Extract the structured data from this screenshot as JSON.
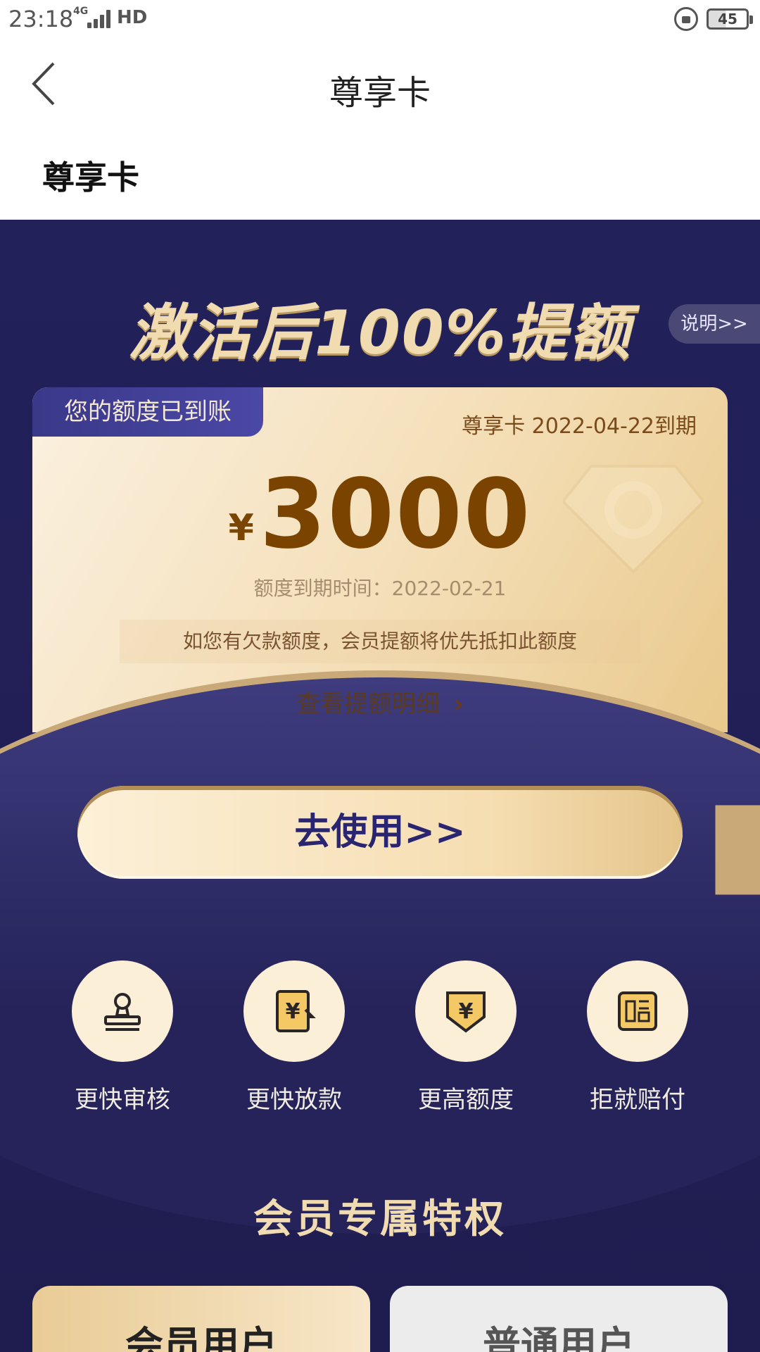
{
  "status_bar": {
    "time": "23:18",
    "network": "4G",
    "hd": "HD",
    "battery": "45"
  },
  "header": {
    "title": "尊享卡",
    "back_icon": "chevron-left-icon"
  },
  "section_title": "尊享卡",
  "banner": {
    "headline": "激活后100%提额",
    "explain_label": "说明>>"
  },
  "card": {
    "badge": "您的额度已到账",
    "expire_label": "尊享卡 2022-04-22到期",
    "currency": "¥",
    "amount": "3000",
    "amount_expire": "额度到期时间：2022-02-21",
    "notice": "如您有欠款额度，会员提额将优先抵扣此额度",
    "detail_link": "查看提额明细",
    "detail_chevron": "›"
  },
  "use_button": "去使用>>",
  "features": [
    {
      "label": "更快审核",
      "icon": "stamp-icon"
    },
    {
      "label": "更快放款",
      "icon": "yuan-document-icon"
    },
    {
      "label": "更高额度",
      "icon": "yuan-shield-icon"
    },
    {
      "label": "拒就赔付",
      "icon": "compensation-icon"
    }
  ],
  "privilege_title": "会员专属特权",
  "tabs": {
    "member": "会员用户",
    "normal": "普通用户"
  },
  "colors": {
    "background_dark": "#23215a",
    "gold_text": "#f0dcb0",
    "amount_brown": "#7a4300"
  }
}
